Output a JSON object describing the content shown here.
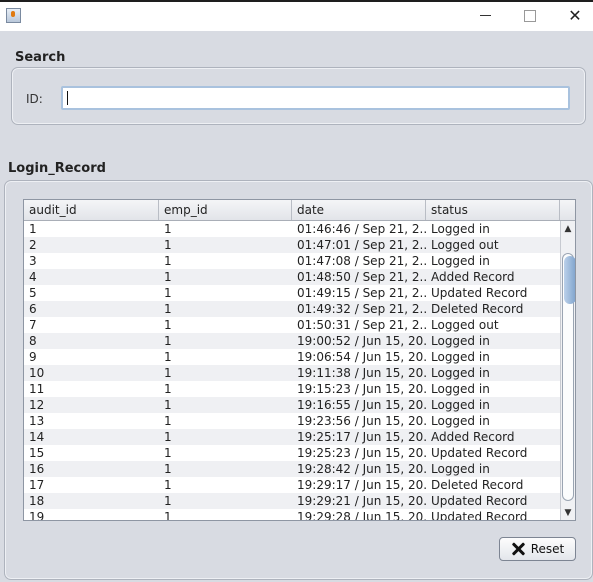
{
  "window": {
    "title": ""
  },
  "search": {
    "title": "Search",
    "id_label": "ID:",
    "id_value": "",
    "id_placeholder": ""
  },
  "record": {
    "title": "Login_Record",
    "columns": [
      "audit_id",
      "emp_id",
      "date",
      "status"
    ],
    "rows": [
      [
        "1",
        "1",
        "01:46:46 / Sep 21, 2...",
        "Logged in"
      ],
      [
        "2",
        "1",
        "01:47:01 / Sep 21, 2...",
        "Logged out"
      ],
      [
        "3",
        "1",
        "01:47:08 / Sep 21, 2...",
        "Logged in"
      ],
      [
        "4",
        "1",
        "01:48:50 / Sep 21, 2...",
        "Added Record"
      ],
      [
        "5",
        "1",
        "01:49:15 / Sep 21, 2...",
        "Updated Record"
      ],
      [
        "6",
        "1",
        "01:49:32 / Sep 21, 2...",
        "Deleted Record"
      ],
      [
        "7",
        "1",
        "01:50:31 / Sep 21, 2...",
        "Logged out"
      ],
      [
        "8",
        "1",
        "19:00:52 / Jun 15, 20...",
        "Logged in"
      ],
      [
        "9",
        "1",
        "19:06:54 / Jun 15, 20...",
        "Logged in"
      ],
      [
        "10",
        "1",
        "19:11:38 / Jun 15, 20...",
        "Logged in"
      ],
      [
        "11",
        "1",
        "19:15:23 / Jun 15, 20...",
        "Logged in"
      ],
      [
        "12",
        "1",
        "19:16:55 / Jun 15, 20...",
        "Logged in"
      ],
      [
        "13",
        "1",
        "19:23:56 / Jun 15, 20...",
        "Logged in"
      ],
      [
        "14",
        "1",
        "19:25:17 / Jun 15, 20...",
        "Added Record"
      ],
      [
        "15",
        "1",
        "19:25:23 / Jun 15, 20...",
        "Updated Record"
      ],
      [
        "16",
        "1",
        "19:28:42 / Jun 15, 20...",
        "Logged in"
      ],
      [
        "17",
        "1",
        "19:29:17 / Jun 15, 20...",
        "Deleted Record"
      ],
      [
        "18",
        "1",
        "19:29:21 / Jun 15, 20...",
        "Updated Record"
      ],
      [
        "19",
        "1",
        "19:29:28 / Jun 15, 20...",
        "Updated Record"
      ]
    ]
  },
  "buttons": {
    "reset_label": "Reset"
  },
  "icons": {
    "app": "java-cup-icon",
    "minimize": "minimize-icon",
    "maximize": "maximize-icon",
    "close": "close-icon",
    "reset": "x-icon",
    "scroll_up": "triangle-up-icon",
    "scroll_down": "triangle-down-icon"
  }
}
